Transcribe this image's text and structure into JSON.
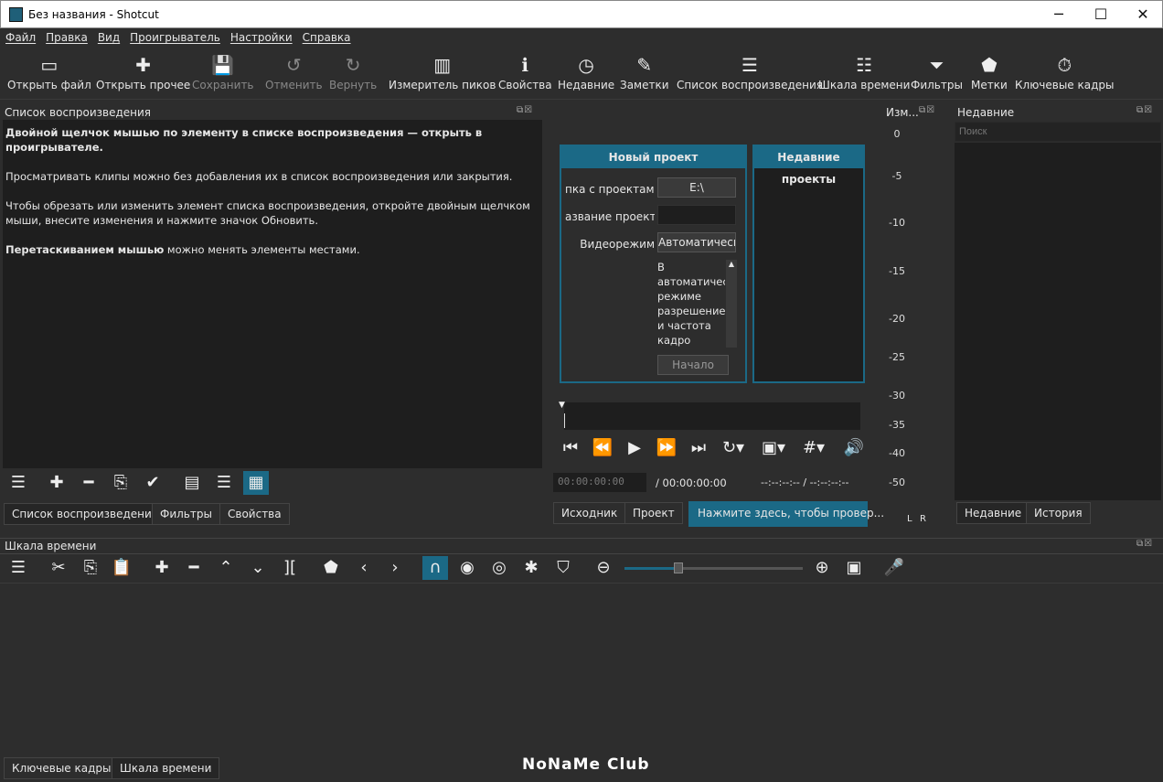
{
  "window": {
    "title": "Без названия - Shotcut",
    "minimize": "─",
    "maximize": "☐",
    "close": "✕"
  },
  "menu": [
    "Файл",
    "Правка",
    "Вид",
    "Проигрыватель",
    "Настройки",
    "Справка"
  ],
  "toolbar": [
    {
      "label": "Открыть файл",
      "icon": "folder-open-icon",
      "glyph": "▭",
      "enabled": true
    },
    {
      "label": "Открыть прочее",
      "icon": "open-other-icon",
      "glyph": "✚",
      "enabled": true
    },
    {
      "label": "Сохранить",
      "icon": "save-icon",
      "glyph": "💾",
      "enabled": false
    },
    {
      "label": "Отменить",
      "icon": "undo-icon",
      "glyph": "↺",
      "enabled": false
    },
    {
      "label": "Вернуть",
      "icon": "redo-icon",
      "glyph": "↻",
      "enabled": false
    },
    {
      "label": "Измеритель пиков",
      "icon": "peak-meter-icon",
      "glyph": "▥",
      "enabled": true
    },
    {
      "label": "Свойства",
      "icon": "info-icon",
      "glyph": "ℹ",
      "enabled": true
    },
    {
      "label": "Недавние",
      "icon": "clock-icon",
      "glyph": "◷",
      "enabled": true
    },
    {
      "label": "Заметки",
      "icon": "notes-icon",
      "glyph": "✎",
      "enabled": true
    },
    {
      "label": "Список воспроизведения",
      "icon": "list-icon",
      "glyph": "☰",
      "enabled": true
    },
    {
      "label": "Шкала времени",
      "icon": "timeline-icon",
      "glyph": "☷",
      "enabled": true
    },
    {
      "label": "Фильтры",
      "icon": "filter-icon",
      "glyph": "⏷",
      "enabled": true
    },
    {
      "label": "Метки",
      "icon": "marker-icon",
      "glyph": "⬟",
      "enabled": true
    },
    {
      "label": "Ключевые кадры",
      "icon": "stopwatch-icon",
      "glyph": "⏱",
      "enabled": true
    }
  ],
  "playlist": {
    "title": "Список воспроизведения",
    "hint1_bold": "Двойной щелчок мышью по элементу в списке воспроизведения — открыть в проигрывателе.",
    "hint2": "Просматривать клипы можно без добавления их в список воспроизведения или закрытия.",
    "hint3": "Чтобы обрезать или изменить элемент списка воспроизведения, откройте двойным щелчком мыши, внесите изменения и нажмите значок Обновить.",
    "hint4_bold": "Перетаскиванием мышью",
    "hint4_rest": " можно менять элементы местами.",
    "tabs": [
      "Список воспроизведения",
      "Фильтры",
      "Свойства"
    ]
  },
  "player": {
    "new_project": {
      "title": "Новый проект",
      "folder_label": "пка с проектами",
      "folder_value": "E:\\",
      "name_label": "азвание проекта",
      "name_value": "",
      "mode_label": "Видеорежим",
      "mode_value": "Автоматически",
      "description": "В автоматическ режиме разрешение и частота кадро выбираются п",
      "start_button": "Начало"
    },
    "recent_projects_title": "Недавние проекты",
    "timecode": "00:00:00:00",
    "duration": "/ 00:00:00:00",
    "in_out": "--:--:--:-- /  --:--:--:--",
    "tabs": [
      "Исходник",
      "Проект"
    ],
    "update_notice": "Нажмите здесь, чтобы провер..."
  },
  "meter": {
    "title": "Изм...",
    "scale": [
      "0",
      "-5",
      "-10",
      "-15",
      "-20",
      "-25",
      "-30",
      "-35",
      "-40",
      "-50"
    ],
    "channels": [
      "L",
      "R"
    ]
  },
  "recent": {
    "title": "Недавние",
    "search_placeholder": "Поиск",
    "tabs": [
      "Недавние",
      "История"
    ]
  },
  "timeline": {
    "title": "Шкала времени",
    "zoom_level": 0.3,
    "tabs": [
      "Ключевые кадры",
      "Шкала времени"
    ]
  },
  "watermark": "NoNaMe Club",
  "colors": {
    "accent": "#1b6986",
    "panel": "#2d2d2d",
    "dark": "#1e1e1e"
  }
}
